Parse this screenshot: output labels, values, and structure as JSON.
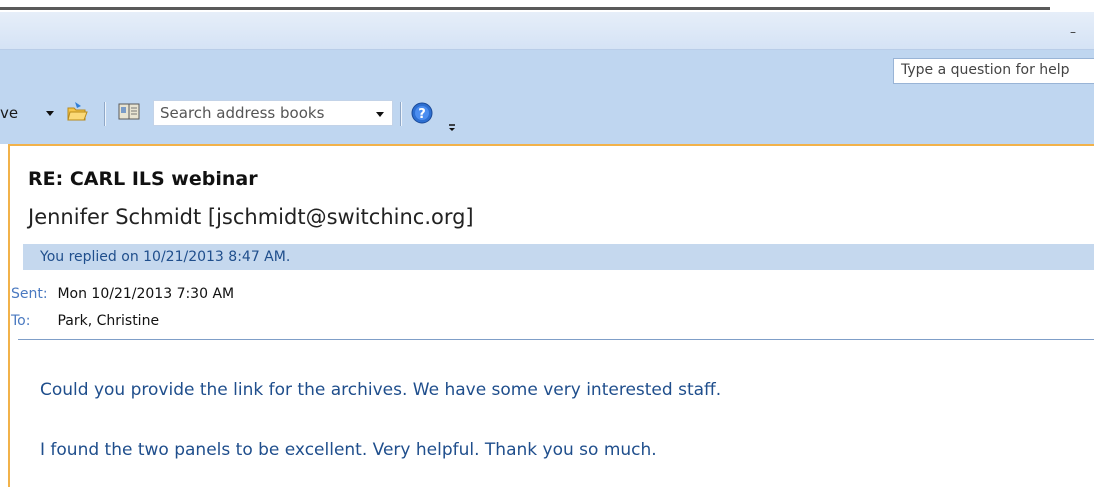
{
  "window": {
    "minimize_glyph": "–"
  },
  "help": {
    "question_placeholder": "Type a question for help"
  },
  "toolbar": {
    "move_label": "ve",
    "search_placeholder": "Search address books",
    "icons": [
      "move-folder-icon",
      "address-book-icon",
      "help-icon",
      "toolbar-options-icon"
    ]
  },
  "message": {
    "subject": "RE: CARL ILS webinar",
    "from": "Jennifer Schmidt [jschmidt@switchinc.org]",
    "info_bar": "You replied on 10/21/2013 8:47 AM.",
    "sent_label": "Sent:",
    "sent_value": "Mon 10/21/2013 7:30 AM",
    "to_label": "To:",
    "to_value": "Park, Christine",
    "body": [
      "Could you provide the link for the archives. We have some very interested staff.",
      "I found the two panels to be excellent. Very helpful. Thank you so much."
    ]
  },
  "colors": {
    "ribbon": "#bfd6f0",
    "accent_border": "#f2b24a",
    "header_label": "#4a79c0",
    "body_text": "#1f4e8c"
  }
}
